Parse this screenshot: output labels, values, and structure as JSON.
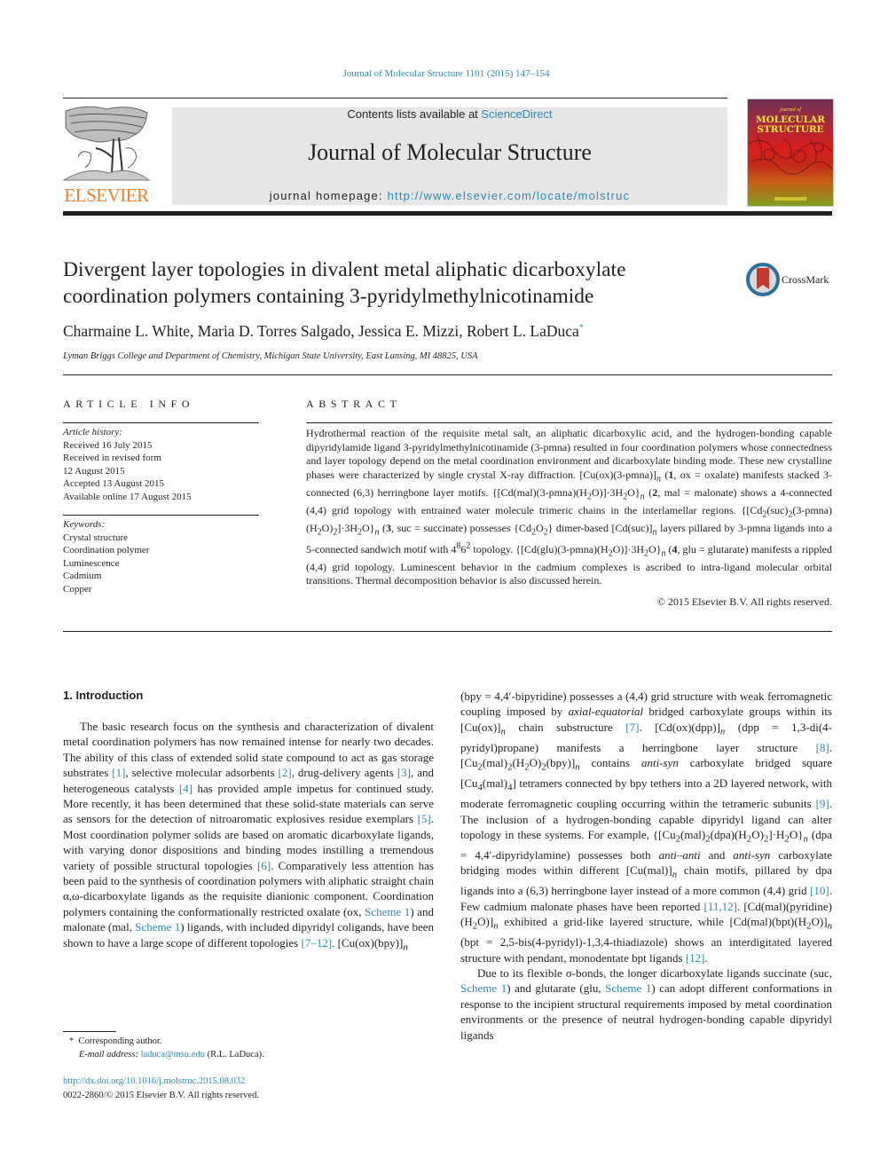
{
  "citation": "Journal of Molecular Structure 1101 (2015) 147–154",
  "header": {
    "publisher_logo_text": "ELSEVIER",
    "contents_prefix": "Contents lists available at ",
    "contents_link": "ScienceDirect",
    "journal_name": "Journal of Molecular Structure",
    "homepage_prefix": "journal homepage: ",
    "homepage_url": "http://www.elsevier.com/locate/molstruc",
    "cover_title_line1": "MOLECULAR",
    "cover_title_line2": "STRUCTURE",
    "cover_small": "journal of"
  },
  "article": {
    "title_line1": "Divergent layer topologies in divalent metal aliphatic dicarboxylate",
    "title_line2": "coordination polymers containing 3-pyridylmethylnicotinamide",
    "crossmark_label": "CrossMark",
    "authors": "Charmaine L. White, Maria D. Torres Salgado, Jessica E. Mizzi, Robert L. LaDuca",
    "author_marker": "*",
    "affiliation": "Lyman Briggs College and Department of Chemistry, Michigan State University, East Lansing, MI 48825, USA"
  },
  "article_info": {
    "heading": "ARTICLE INFO",
    "history_label": "Article history:",
    "history": [
      "Received 16 July 2015",
      "Received in revised form",
      "12 August 2015",
      "Accepted 13 August 2015",
      "Available online 17 August 2015"
    ],
    "keywords_label": "Keywords:",
    "keywords": [
      "Crystal structure",
      "Coordination polymer",
      "Luminescence",
      "Cadmium",
      "Copper"
    ]
  },
  "abstract": {
    "heading": "ABSTRACT",
    "copyright": "© 2015 Elsevier B.V. All rights reserved."
  },
  "body": {
    "intro_heading": "1.  Introduction"
  },
  "colors": {
    "link": "#2a8ab7",
    "elsevier_orange": "#f07e26",
    "header_gray": "#e6e6e6",
    "text": "#231f20"
  },
  "footnote": {
    "marker": "*",
    "corresponding": "Corresponding author.",
    "email_label": "E-mail address:",
    "email": "laduca@msu.edu",
    "email_suffix": " (R.L. LaDuca).",
    "doi": "http://dx.doi.org/10.1016/j.molstruc.2015.08.032",
    "issn_line": "0022-2860/© 2015 Elsevier B.V. All rights reserved."
  }
}
